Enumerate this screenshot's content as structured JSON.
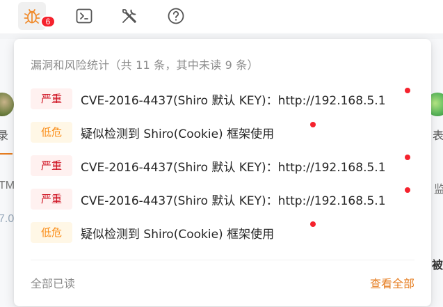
{
  "toolbar": {
    "unread_count": "6"
  },
  "background": {
    "left_label": "录",
    "right_label": "表",
    "left_tm": "TM",
    "left_num": "7.0",
    "right_mon": "监",
    "right_cut": "被"
  },
  "panel": {
    "title": "漏洞和风险统计（共 11 条，其中未读 9 条）",
    "items": [
      {
        "level": "严重",
        "severity": "severe",
        "text": "CVE-2016-4437(Shiro 默认 KEY)：http://192.168.5.1",
        "unread": true
      },
      {
        "level": "低危",
        "severity": "low",
        "text": "疑似检测到 Shiro(Cookie) 框架使用",
        "unread": true
      },
      {
        "level": "严重",
        "severity": "severe",
        "text": "CVE-2016-4437(Shiro 默认 KEY)：http://192.168.5.1",
        "unread": true
      },
      {
        "level": "严重",
        "severity": "severe",
        "text": "CVE-2016-4437(Shiro 默认 KEY)：http://192.168.5.1",
        "unread": true
      },
      {
        "level": "低危",
        "severity": "low",
        "text": "疑似检测到 Shiro(Cookie) 框架使用",
        "unread": true
      }
    ],
    "mark_all_read": "全部已读",
    "view_all": "查看全部"
  },
  "colors": {
    "severe_bg": "#fff1f0",
    "severe_fg": "#cf1322",
    "low_bg": "#fff7e6",
    "low_fg": "#fa8c16",
    "accent": "#e67e22",
    "badge": "#f5222d"
  }
}
